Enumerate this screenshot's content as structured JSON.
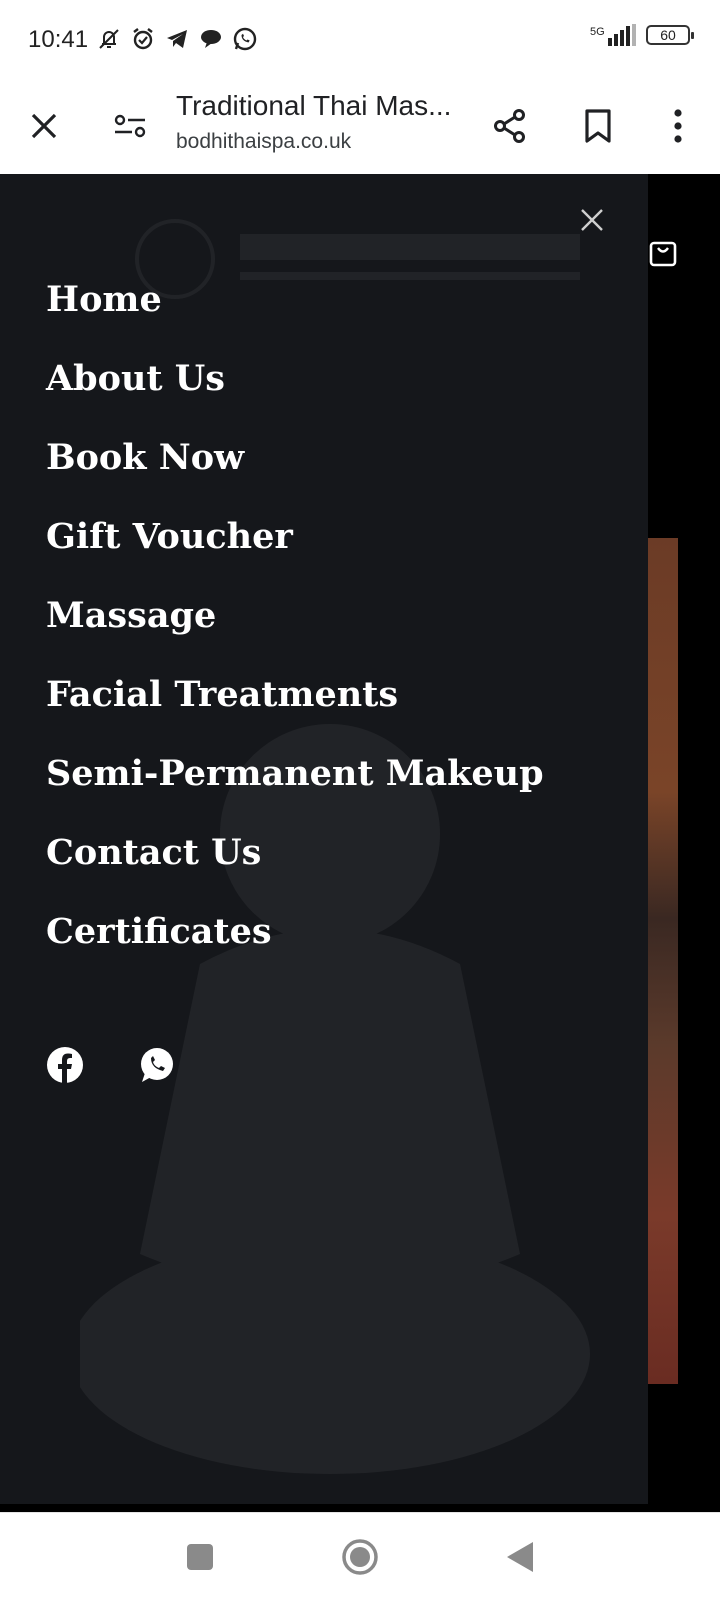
{
  "status_bar": {
    "time": "10:41",
    "network": "5G",
    "battery": "60",
    "icons": [
      "mute-vibrate-icon",
      "alarm-icon",
      "telegram-icon",
      "chat-icon",
      "whatsapp-icon"
    ]
  },
  "browser": {
    "title": "Traditional Thai Mas...",
    "url": "bodhithaispa.co.uk",
    "icons": [
      "close-icon",
      "site-settings-icon",
      "share-icon",
      "bookmark-icon",
      "more-vert-icon"
    ]
  },
  "drawer": {
    "menu": [
      "Home",
      "About Us",
      "Book Now",
      "Gift Voucher",
      "Massage",
      "Facial Treatments",
      "Semi-Permanent Makeup",
      "Contact Us",
      "Certificates"
    ],
    "socials": [
      "facebook-icon",
      "whatsapp-icon"
    ]
  },
  "nav_bar": {
    "buttons": [
      "recents-button",
      "home-button",
      "back-button"
    ]
  },
  "colors": {
    "drawer_bg": "#15171b",
    "menu_text": "#ffffff",
    "bars_bg": "#ffffff"
  }
}
